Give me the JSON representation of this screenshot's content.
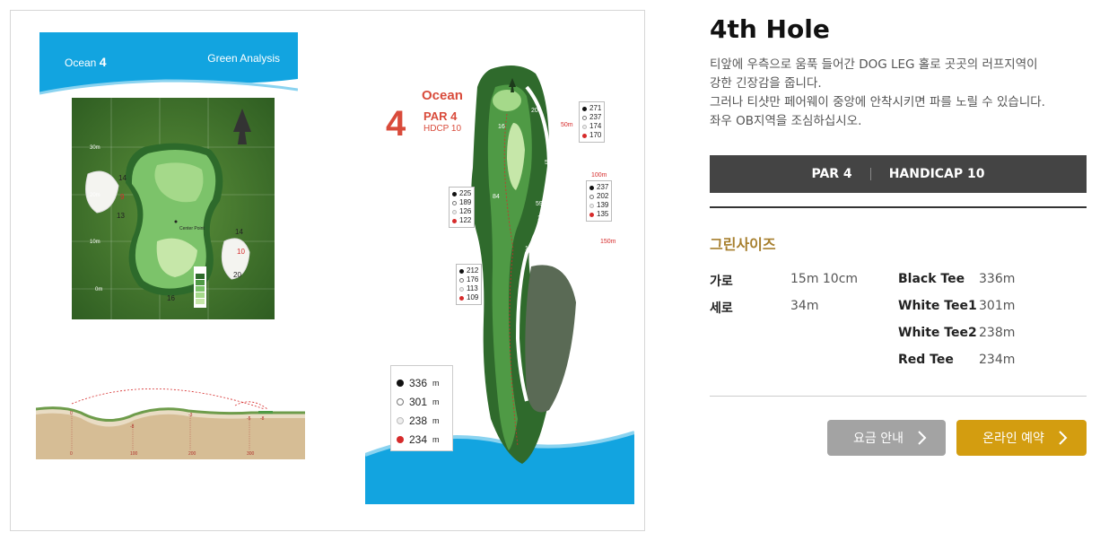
{
  "course_map": {
    "green_analysis": {
      "course_name": "Ocean",
      "hole_number": "4",
      "title": "Green Analysis",
      "scale_labels": [
        "30m",
        "20m",
        "10m",
        "0m"
      ],
      "pin_labels": [
        "9",
        "13",
        "14",
        "10",
        "20",
        "16"
      ],
      "center_label": "Center Point"
    },
    "hole_diagram": {
      "course_name": "Ocean",
      "hole_number": "4",
      "par": "PAR 4",
      "hdcp": "HDCP 10",
      "distance_boxes": [
        {
          "values": [
            "271",
            "237",
            "174",
            "170"
          ]
        },
        {
          "values": [
            "225",
            "189",
            "126",
            "122"
          ]
        },
        {
          "values": [
            "237",
            "202",
            "139",
            "135"
          ]
        },
        {
          "values": [
            "212",
            "176",
            "113",
            "109"
          ]
        }
      ],
      "markers": [
        "50m",
        "100m",
        "150m"
      ],
      "yardage_labels": [
        "16",
        "20",
        "57",
        "77",
        "84",
        "59",
        "106",
        "116",
        "20",
        "191"
      ]
    },
    "tee_legend": [
      {
        "color": "black",
        "value": "336",
        "unit": "m"
      },
      {
        "color": "white",
        "value": "301",
        "unit": "m"
      },
      {
        "color": "silver",
        "value": "238",
        "unit": "m"
      },
      {
        "color": "red",
        "value": "234",
        "unit": "m"
      }
    ]
  },
  "info": {
    "title": "4th Hole",
    "description_lines": [
      "티앞에 우측으로 움푹 들어간 DOG LEG 홀로 곳곳의 러프지역이",
      "강한 긴장감을 줍니다.",
      "그러나 티샷만 페어웨이 중앙에 안착시키면 파를 노릴 수 있습니다.",
      "좌우 OB지역을 조심하십시오."
    ],
    "summary": {
      "par": "PAR 4",
      "handicap": "HANDICAP 10"
    },
    "green_size_title": "그린사이즈",
    "green_size": [
      {
        "label": "가로",
        "value": "15m 10cm"
      },
      {
        "label": "세로",
        "value": "34m"
      }
    ],
    "tees": [
      {
        "label": "Black Tee",
        "value": "336m"
      },
      {
        "label": "White Tee1",
        "value": "301m"
      },
      {
        "label": "White Tee2",
        "value": "238m"
      },
      {
        "label": "Red Tee",
        "value": "234m"
      }
    ],
    "buttons": {
      "fee": "요금 안내",
      "booking": "온라인 예약"
    }
  },
  "colors": {
    "accent_gold": "#d39d10",
    "section_title": "#a77f2e",
    "summary_bar": "#444444",
    "button_grey": "#a3a3a3",
    "ocean_blue": "#11a3e0",
    "hole_red": "#d94b3b"
  }
}
